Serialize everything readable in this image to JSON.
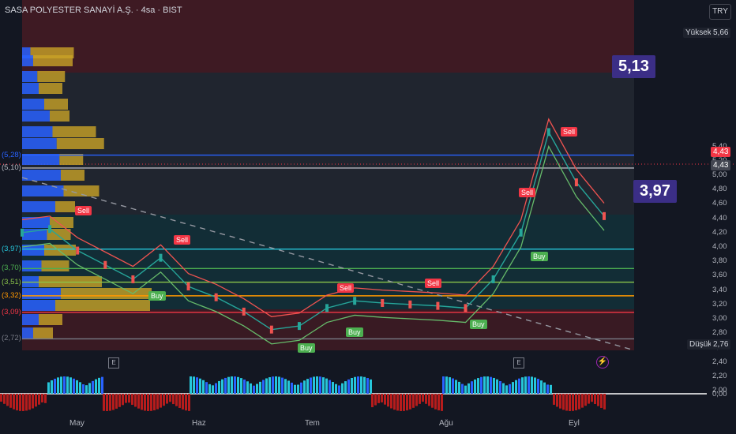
{
  "header": {
    "title": "SASA POLYESTER SANAYİ A.Ş. · 4sa · BIST",
    "currency": "TRY"
  },
  "levels": [
    {
      "label": "(5,28)",
      "value": 5.28,
      "color": "#2962ff"
    },
    {
      "label": "(5,10)",
      "value": 5.1,
      "color": "#b2b5be"
    },
    {
      "label": "(3,97)",
      "value": 3.97,
      "color": "#26c6da"
    },
    {
      "label": "(3,70)",
      "value": 3.7,
      "color": "#4caf50"
    },
    {
      "label": "(3,51)",
      "value": 3.51,
      "color": "#8bc34a"
    },
    {
      "label": "(3,32)",
      "value": 3.32,
      "color": "#ff9800"
    },
    {
      "label": "(3,09)",
      "value": 3.09,
      "color": "#f23645"
    },
    {
      "label": "(2,72)",
      "value": 2.72,
      "color": "#787b86"
    }
  ],
  "price_axis": {
    "ticks": [
      "5,40",
      "5,20",
      "5,00",
      "4,80",
      "4,60",
      "4,40",
      "4,20",
      "4,00",
      "3,80",
      "3,60",
      "3,40",
      "3,20",
      "3,00",
      "2,80",
      "2,60",
      "2,40",
      "2,20",
      "2,00"
    ],
    "high_label": "Yüksek",
    "high_value": "5,66",
    "low_label": "Düşük",
    "low_value": "2,76",
    "last_price": "4,43",
    "last_price2": "4,43",
    "oscillator_zero": "0,00"
  },
  "time_axis": {
    "labels": [
      "May",
      "Haz",
      "Tem",
      "Ağu",
      "Eyl"
    ]
  },
  "annotations": {
    "target_high": "5,13",
    "target_low": "3,97",
    "event_marker": "E"
  },
  "signals": {
    "sell": [
      {
        "label": "Sell",
        "date": "late Apr",
        "price": 4.35
      },
      {
        "label": "Sell",
        "date": "late May",
        "price": 3.95
      },
      {
        "label": "Sell",
        "date": "mid Jul",
        "price": 3.28
      },
      {
        "label": "Sell",
        "date": "late Jul",
        "price": 3.34
      },
      {
        "label": "Sell",
        "date": "late Aug",
        "price": 4.6
      },
      {
        "label": "Sell",
        "date": "early Sep",
        "price": 5.45
      }
    ],
    "buy": [
      {
        "label": "Buy",
        "date": "mid May",
        "price": 3.45
      },
      {
        "label": "Buy",
        "date": "late Jun",
        "price": 2.72
      },
      {
        "label": "Buy",
        "date": "mid Jul",
        "price": 2.95
      },
      {
        "label": "Buy",
        "date": "mid Aug",
        "price": 3.05
      },
      {
        "label": "Buy",
        "date": "late Aug",
        "price": 4.0
      }
    ]
  },
  "chart_data": {
    "type": "line",
    "symbol": "SASA",
    "interval": "4sa",
    "exchange": "BIST",
    "x": [
      "Apr-22",
      "Apr-29",
      "May-06",
      "May-13",
      "May-20",
      "May-27",
      "Jun-03",
      "Jun-10",
      "Jun-17",
      "Jun-24",
      "Jul-01",
      "Jul-08",
      "Jul-15",
      "Jul-22",
      "Jul-29",
      "Aug-05",
      "Aug-12",
      "Aug-19",
      "Aug-26",
      "Sep-02",
      "Sep-09",
      "Sep-16"
    ],
    "series": [
      {
        "values": [
          4.2,
          4.25,
          3.95,
          3.75,
          3.55,
          3.85,
          3.45,
          3.3,
          3.1,
          2.85,
          2.9,
          3.15,
          3.25,
          3.22,
          3.2,
          3.18,
          3.15,
          3.55,
          4.2,
          5.6,
          4.9,
          4.43
        ]
      }
    ],
    "ylim": [
      2.0,
      5.7
    ],
    "y_ticks": [
      5.4,
      5.2,
      5.0,
      4.8,
      4.6,
      4.4,
      4.2,
      4.0,
      3.8,
      3.6,
      3.4,
      3.2,
      3.0,
      2.8,
      2.6,
      2.4,
      2.2,
      2.0
    ],
    "high": 5.66,
    "low": 2.76,
    "last": 4.43
  },
  "colors": {
    "up": "#26a69a",
    "down": "#ef5350",
    "sell": "#f23645",
    "buy": "#4caf50",
    "target": "#3b2e86"
  }
}
